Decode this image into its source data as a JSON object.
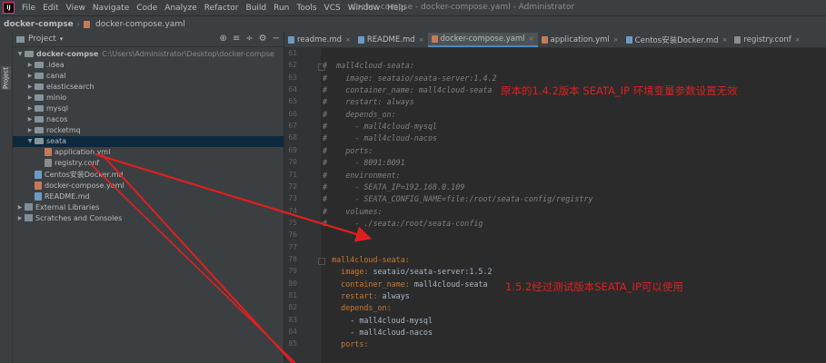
{
  "menubar": {
    "app_icon": "IJ",
    "items": [
      "File",
      "Edit",
      "View",
      "Navigate",
      "Code",
      "Analyze",
      "Refactor",
      "Build",
      "Run",
      "Tools",
      "VCS",
      "Window",
      "Help"
    ],
    "window_title": "docker-compse - docker-compose.yaml - Administrator"
  },
  "navbar": {
    "crumbs": [
      "docker-compse",
      "docker-compose.yaml"
    ]
  },
  "left_strip": {
    "label": "Project"
  },
  "project_panel": {
    "title": "Project",
    "tree": [
      {
        "label": "docker-compse",
        "hint": "C:\\Users\\Administrator\\Desktop\\docker-compse",
        "type": "folder",
        "level": 0,
        "expanded": true
      },
      {
        "label": ".idea",
        "type": "folder",
        "level": 1,
        "expanded": false
      },
      {
        "label": "canal",
        "type": "folder",
        "level": 1,
        "expanded": false
      },
      {
        "label": "elasticsearch",
        "type": "folder",
        "level": 1,
        "expanded": false
      },
      {
        "label": "minio",
        "type": "folder",
        "level": 1,
        "expanded": false
      },
      {
        "label": "mysql",
        "type": "folder",
        "level": 1,
        "expanded": false
      },
      {
        "label": "nacos",
        "type": "folder",
        "level": 1,
        "expanded": false
      },
      {
        "label": "rocketmq",
        "type": "folder",
        "level": 1,
        "expanded": false
      },
      {
        "label": "seata",
        "type": "folder",
        "level": 1,
        "expanded": true,
        "selected": true
      },
      {
        "label": "application.yml",
        "type": "yml",
        "level": 2
      },
      {
        "label": "registry.conf",
        "type": "conf",
        "level": 2
      },
      {
        "label": "Centos安装Docker.md",
        "type": "md",
        "level": 1
      },
      {
        "label": "docker-compose.yaml",
        "type": "yml",
        "level": 1
      },
      {
        "label": "README.md",
        "type": "md",
        "level": 1
      },
      {
        "label": "External Libraries",
        "type": "lib",
        "level": 0,
        "expanded": false
      },
      {
        "label": "Scratches and Consoles",
        "type": "lib",
        "level": 0,
        "expanded": false
      }
    ]
  },
  "tabs": [
    {
      "label": "readme.md",
      "type": "md"
    },
    {
      "label": "README.md",
      "type": "md"
    },
    {
      "label": "docker-compose.yaml",
      "type": "yml",
      "active": true
    },
    {
      "label": "application.yml",
      "type": "yml"
    },
    {
      "label": "Centos安装Docker.md",
      "type": "md"
    },
    {
      "label": "registry.conf",
      "type": "conf"
    }
  ],
  "editor": {
    "lines": [
      {
        "n": "61",
        "t": "",
        "c": "plain"
      },
      {
        "n": "62",
        "t": "#  mall4cloud-seata:",
        "c": "cmt"
      },
      {
        "n": "63",
        "t": "#    image: seataio/seata-server:1.4.2",
        "c": "cmt"
      },
      {
        "n": "64",
        "t": "#    container_name: mall4cloud-seata",
        "c": "cmt"
      },
      {
        "n": "65",
        "t": "#    restart: always",
        "c": "cmt"
      },
      {
        "n": "66",
        "t": "#    depends_on:",
        "c": "cmt"
      },
      {
        "n": "67",
        "t": "#      - mall4cloud-mysql",
        "c": "cmt"
      },
      {
        "n": "68",
        "t": "#      - mall4cloud-nacos",
        "c": "cmt"
      },
      {
        "n": "69",
        "t": "#    ports:",
        "c": "cmt"
      },
      {
        "n": "70",
        "t": "#      - 8091:8091",
        "c": "cmt"
      },
      {
        "n": "71",
        "t": "#    environment:",
        "c": "cmt"
      },
      {
        "n": "72",
        "t": "#      - SEATA_IP=192.168.0.109",
        "c": "cmt"
      },
      {
        "n": "73",
        "t": "#      - SEATA_CONFIG_NAME=file:/root/seata-config/registry",
        "c": "cmt"
      },
      {
        "n": "74",
        "t": "#    volumes:",
        "c": "cmt"
      },
      {
        "n": "75",
        "t": "#      - ./seata:/root/seata-config",
        "c": "cmt"
      },
      {
        "n": "76",
        "t": "",
        "c": "plain"
      },
      {
        "n": "77",
        "t": "",
        "c": "plain"
      },
      {
        "n": "78",
        "t": "  mall4cloud-seata:",
        "c": "key"
      },
      {
        "n": "79",
        "t": "    image: seataio/seata-server:1.5.2",
        "c": "kv",
        "k": "    image:",
        "v": " seataio/seata-server:1.5.2"
      },
      {
        "n": "80",
        "t": "    container_name: mall4cloud-seata",
        "c": "kv",
        "k": "    container_name:",
        "v": " mall4cloud-seata"
      },
      {
        "n": "81",
        "t": "    restart: always",
        "c": "kv",
        "k": "    restart:",
        "v": " always"
      },
      {
        "n": "82",
        "t": "    depends_on:",
        "c": "key"
      },
      {
        "n": "83",
        "t": "      - mall4cloud-mysql",
        "c": "val"
      },
      {
        "n": "84",
        "t": "      - mall4cloud-nacos",
        "c": "val"
      },
      {
        "n": "85",
        "t": "    ports:",
        "c": "key"
      }
    ]
  },
  "annotations": {
    "old_version_note": "原本的1.4.2版本 SEATA_IP 环境变量参数设置无效",
    "new_version_note": "1.5.2经过测试版本SEATA_IP可以使用"
  },
  "colors": {
    "annotation": "#e02020",
    "accent": "#4a88c7"
  }
}
